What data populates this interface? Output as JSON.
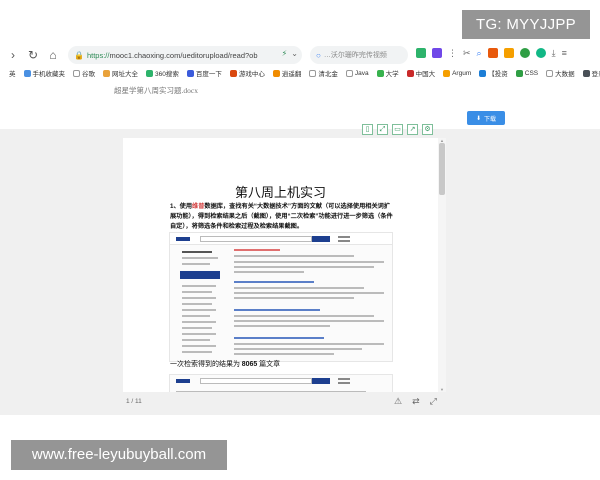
{
  "watermarks": {
    "top": "TG: MYYJJPP",
    "bottom": "www.free-leyubuyball.com"
  },
  "browser": {
    "url_protocol": "https://",
    "url_rest": "mooc1.chaoxing.com/ueditorupload/read?ob",
    "search_placeholder": "…沃尔珊昨完传视频",
    "bookmarks": [
      {
        "label": "英",
        "color": "#ffffff"
      },
      {
        "label": "手机收藏夹",
        "color": "#4a90e2"
      },
      {
        "label": "谷歌",
        "color": "#dddddd"
      },
      {
        "label": "网址大全",
        "color": "#e9a23b"
      },
      {
        "label": "360搜索",
        "color": "#2db36b"
      },
      {
        "label": "百度一下",
        "color": "#3b5bdb"
      },
      {
        "label": "游戏中心",
        "color": "#d9480f"
      },
      {
        "label": "逍遥翻",
        "color": "#f08c00"
      },
      {
        "label": "清北金",
        "color": "#dddddd"
      },
      {
        "label": "Java",
        "color": "#dddddd"
      },
      {
        "label": "大学",
        "color": "#37b24d"
      },
      {
        "label": "中国大",
        "color": "#c92a2a"
      },
      {
        "label": "Argum",
        "color": "#f59f00"
      },
      {
        "label": "【投资",
        "color": "#1c7ed6"
      },
      {
        "label": "CSS",
        "color": "#2f9e44"
      },
      {
        "label": "大数据",
        "color": "#dddddd"
      },
      {
        "label": "登录",
        "color": "#495057"
      }
    ]
  },
  "document": {
    "filename": "超星学第八周实习题.docx",
    "download_label": "下载",
    "heading": "第八周上机实习",
    "question_num": "1、",
    "question_pre": "使用",
    "question_highlight": "维普",
    "question_post": "数据库，查找有关“大数据技术”方面的文献（可以选择使用相关词扩展功能），得到检索结果之后（截图），使用“二次检索”功能进行进一步筛选（条件自定），将筛选条件和检索过程及检索结果截图。",
    "result_pre": "一次检索得到的结果为",
    "result_count": "8065",
    "result_post": "篇文章",
    "page_indicator": "1 / 11"
  },
  "icons": {
    "viewer_tools": [
      "bookmark-icon",
      "expand-icon",
      "slides-icon",
      "share-icon",
      "settings-icon"
    ],
    "bottom_tools": [
      "warning-icon",
      "swap-icon",
      "fullscreen-icon"
    ]
  }
}
